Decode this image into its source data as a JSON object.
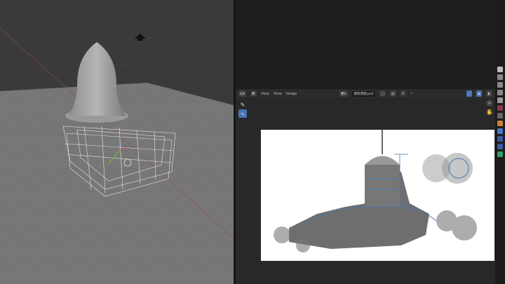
{
  "image_editor": {
    "menus": [
      "View",
      "View",
      "Image"
    ],
    "image_name": "建筑草图.psd"
  },
  "icons": [
    "editor-type-icon",
    "image-icon",
    "eyedropper-icon",
    "draw-icon",
    "zoom-icon",
    "hand-icon",
    "gizmo-icon",
    "overlay-icon",
    "camera-icon"
  ],
  "colors": {
    "accent": "#4772b3",
    "viewport_bg": "#3a3a3a",
    "floor": "#7c7c7c"
  }
}
